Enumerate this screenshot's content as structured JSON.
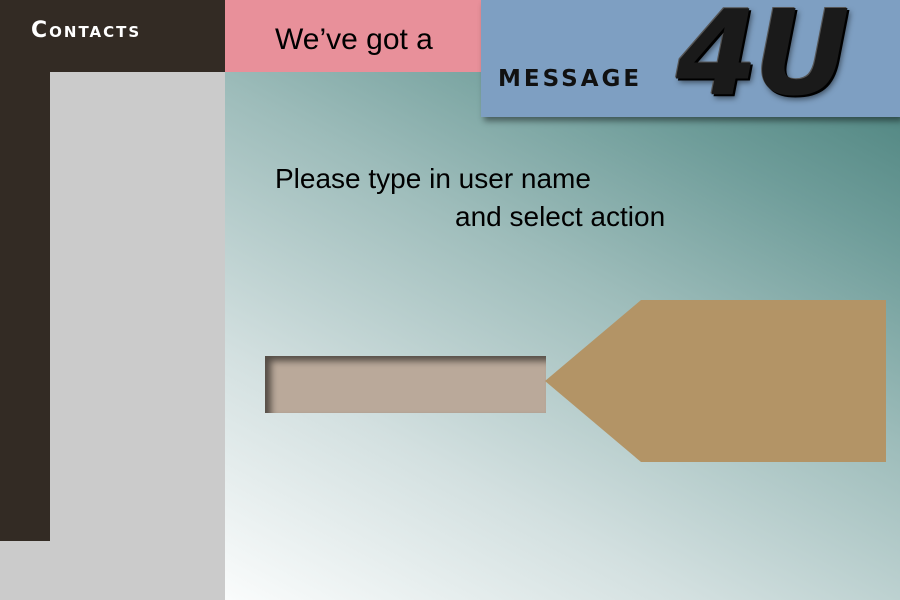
{
  "sidebar": {
    "title": "Contacts",
    "list_items": []
  },
  "header": {
    "tagline": "We’ve got a"
  },
  "logo": {
    "word": "MESSAGE",
    "mark": "4U"
  },
  "main": {
    "instruction_line1": "Please type in user name",
    "instruction_line2": "and select action",
    "username_input": {
      "value": "",
      "placeholder": ""
    },
    "action_arrow": {
      "icon": "arrow-left-icon",
      "label": ""
    }
  },
  "colors": {
    "sidebar_dark": "#332b24",
    "sidebar_light": "#cbcbcb",
    "header_pink": "#e8909a",
    "logo_blue": "#7e9fc2",
    "input_fill": "#baa99a",
    "action_fill": "#b39466",
    "panel_teal": "#4b827d"
  }
}
